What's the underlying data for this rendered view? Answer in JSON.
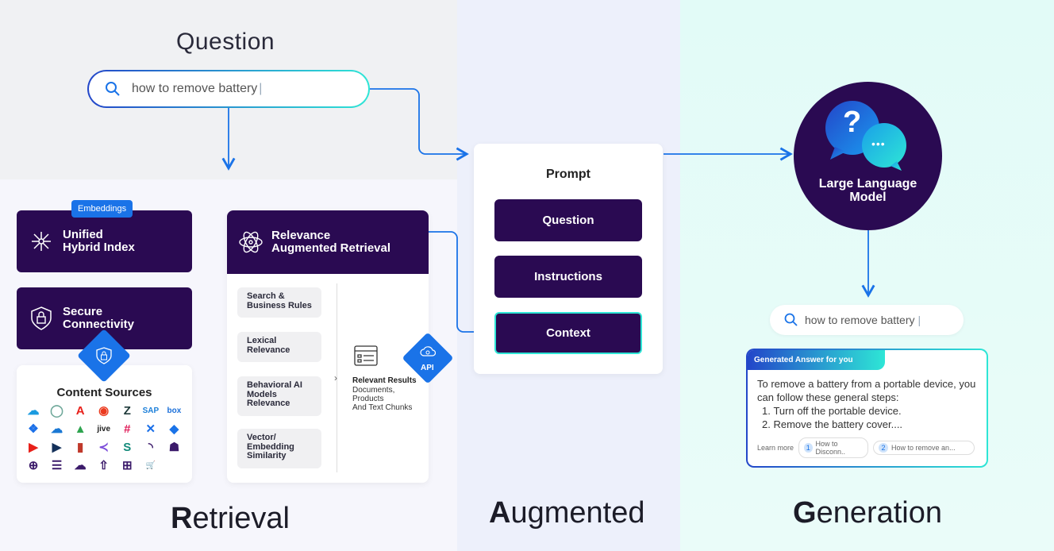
{
  "sections": {
    "question": "Question",
    "retrieval_first": "R",
    "retrieval_rest": "etrieval",
    "augmented_first": "A",
    "augmented_rest": "ugmented",
    "generation_first": "G",
    "generation_rest": "eneration"
  },
  "question_search": {
    "value": "how to remove battery",
    "icon": "search-icon"
  },
  "retrieval": {
    "embeddings_badge": "Embeddings",
    "unified_index": "Unified\nHybrid Index",
    "secure": "Secure\nConnectivity",
    "content_sources": {
      "title": "Content Sources",
      "logos": [
        "salesforce",
        "servicenow",
        "adobe",
        "sitecore",
        "zendesk",
        "SAP",
        "box",
        "dropbox",
        "onedrive",
        "google-drive",
        "jive",
        "slack",
        "confluence",
        "jira",
        "youtube",
        "dynamics",
        "aws-s3",
        "khoros",
        "sharepoint",
        "rss",
        "sitemap",
        "web",
        "database",
        "cloud-sync",
        "cloud-upload",
        "push-api",
        "cart"
      ]
    },
    "rar": {
      "title": "Relevance\nAugmented Retrieval",
      "rules": [
        "Search &\nBusiness Rules",
        "Lexical\nRelevance",
        "Behavioral AI\nModels\nRelevance",
        "Vector/\nEmbedding\nSimilarity"
      ],
      "results_title": "Relevant Results",
      "results_sub": "Documents,\nProducts\nAnd Text Chunks",
      "api": "API"
    }
  },
  "prompt": {
    "title": "Prompt",
    "items": [
      "Question",
      "Instructions",
      "Context"
    ]
  },
  "llm": {
    "label": "Large Language\nModel",
    "q": "?",
    "dots": "•••"
  },
  "answer": {
    "search_value": "how to remove battery",
    "header": "Generated Answer for you",
    "intro": "To remove a battery from a portable device, you can follow these general steps:",
    "steps": [
      "Turn off the portable device.",
      "Remove the battery cover...."
    ],
    "learn_more": "Learn more",
    "links": [
      {
        "n": "1",
        "text": "How to Disconn.."
      },
      {
        "n": "2",
        "text": "How to remove an..."
      }
    ]
  },
  "colors": {
    "dark_purple": "#2a0a52",
    "arrow_blue": "#1a73e8",
    "teal": "#2ee6d6"
  }
}
